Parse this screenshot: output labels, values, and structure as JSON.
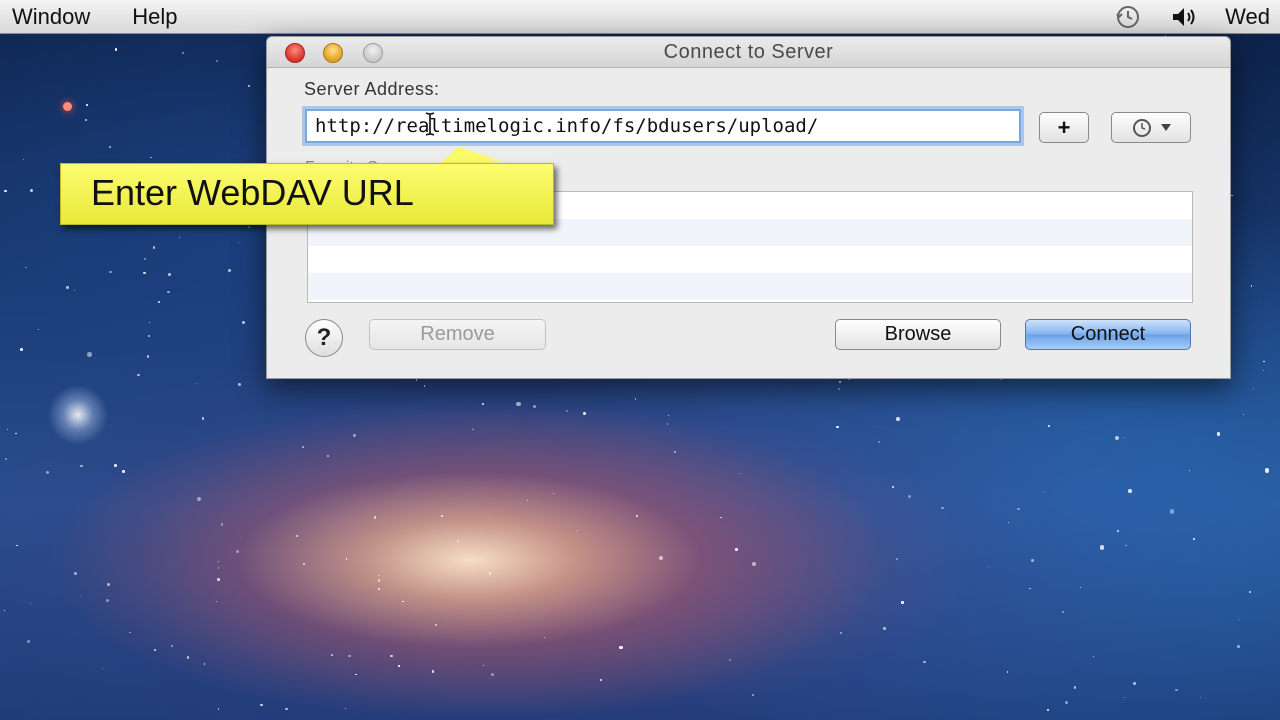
{
  "menubar": {
    "items": [
      "Window",
      "Help"
    ],
    "clock_label": "Wed",
    "icons": [
      "time-machine-icon",
      "volume-icon"
    ]
  },
  "dialog": {
    "title": "Connect to Server",
    "server_address_label": "Server Address:",
    "server_address_value": "http://realtimelogic.info/fs/bdusers/upload/",
    "add_button_label": "+",
    "favorites_list_label": "Favorite Servers:",
    "help_label": "?",
    "remove_label": "Remove",
    "browse_label": "Browse",
    "connect_label": "Connect"
  },
  "callout": {
    "text": "Enter WebDAV URL",
    "color": "#f3f350"
  }
}
